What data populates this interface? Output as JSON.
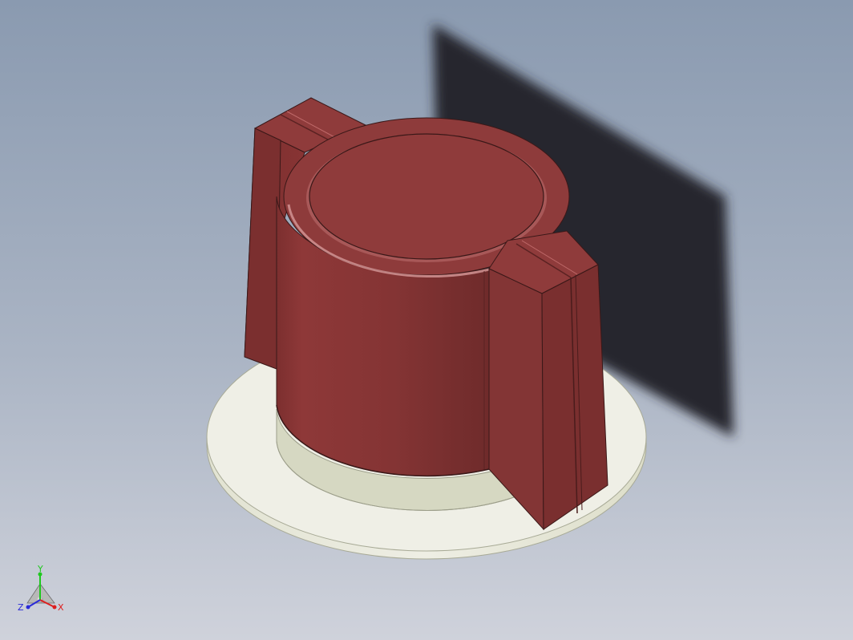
{
  "viewport": {
    "background_top": "#8a9ab0",
    "background_bottom": "#c8ccd6",
    "shadow_color": "#25282e"
  },
  "model": {
    "part": "knob",
    "knob_color": "#8b3a3a",
    "knob_dark": "#6e2c2c",
    "base_color": "#e8e9dc",
    "base_edge": "#d8dac8"
  },
  "triad": {
    "x_label": "X",
    "y_label": "Y",
    "z_label": "Z",
    "x_color": "#dd1e1e",
    "y_color": "#1ec81e",
    "z_color": "#2a2ad8"
  }
}
